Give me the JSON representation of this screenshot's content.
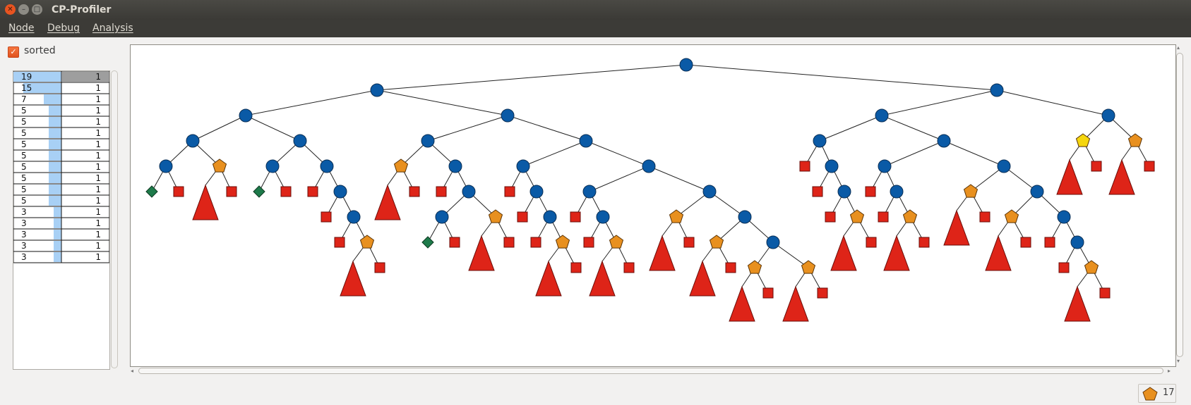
{
  "window": {
    "title": "CP-Profiler"
  },
  "menu": [
    "Node",
    "Debug",
    "Analysis"
  ],
  "sorted": {
    "label": "sorted",
    "checked": true
  },
  "histogram": {
    "rows": [
      {
        "count": 19,
        "value": 1
      },
      {
        "count": 15,
        "value": 1
      },
      {
        "count": 7,
        "value": 1
      },
      {
        "count": 5,
        "value": 1
      },
      {
        "count": 5,
        "value": 1
      },
      {
        "count": 5,
        "value": 1
      },
      {
        "count": 5,
        "value": 1
      },
      {
        "count": 5,
        "value": 1
      },
      {
        "count": 5,
        "value": 1
      },
      {
        "count": 5,
        "value": 1
      },
      {
        "count": 5,
        "value": 1
      },
      {
        "count": 5,
        "value": 1
      },
      {
        "count": 3,
        "value": 1
      },
      {
        "count": 3,
        "value": 1
      },
      {
        "count": 3,
        "value": 1
      },
      {
        "count": 3,
        "value": 1
      },
      {
        "count": 3,
        "value": 1
      }
    ],
    "max": 19
  },
  "status": {
    "count": "17",
    "icon": "pentagon-icon"
  },
  "colors": {
    "branch": "#0a5aa6",
    "solution": "#1e7a4a",
    "failure": "#de2418",
    "subtree_failed": "#de2418",
    "undetermined": "#e8901f",
    "selected": "#f5d60e",
    "bar": "#a8d0f5",
    "accent": "#e95420"
  }
}
